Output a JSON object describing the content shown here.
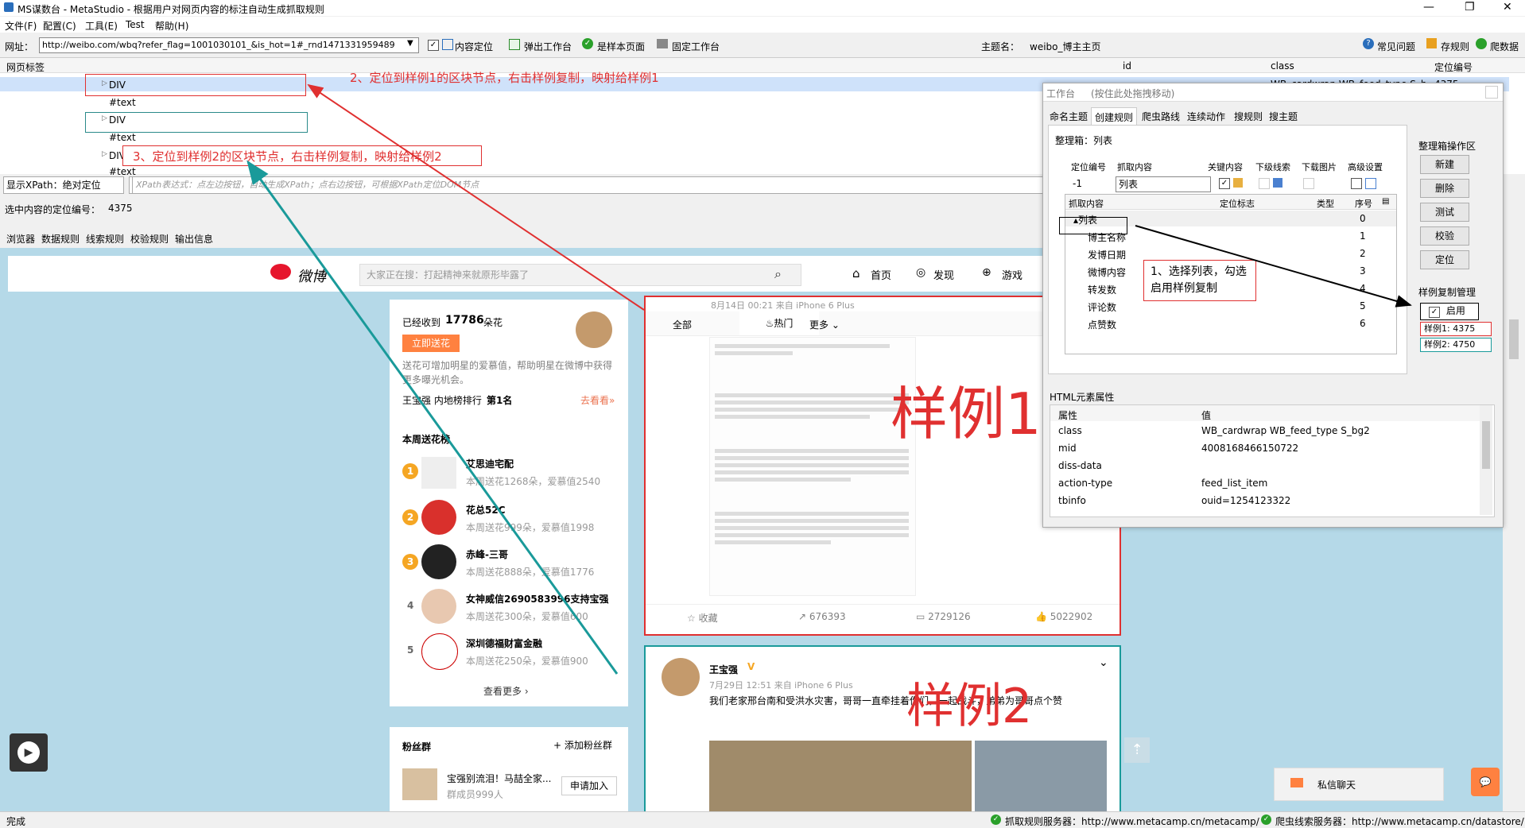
{
  "window": {
    "title": "MS谋数台 - MetaStudio - 根据用户对网页内容的标注自动生成抓取规则",
    "controls": [
      "—",
      "❐",
      "✕"
    ]
  },
  "menu": [
    "文件(F)",
    "配置(C)",
    "工具(E)",
    "Test",
    "帮助(H)"
  ],
  "toolbar": {
    "url_label": "网址：",
    "url_value": "http://weibo.com/wbq?refer_flag=1001030101_&is_hot=1#_rnd1471331959489",
    "content_locate": "内容定位",
    "popup_workbench": "弹出工作台",
    "is_sample_page": "是样本页面",
    "fixed_workbench": "固定工作台",
    "theme_label": "主题名：",
    "theme_value": "weibo_博主主页",
    "faq": "常见问题",
    "save_rule": "存规则",
    "crawl_data": "爬数据"
  },
  "dom_tree": {
    "header": "网页标签",
    "col_id": "id",
    "col_class": "class",
    "col_locate_no": "定位编号",
    "row0_class": "WB_cardwrap WB_feed_type S_b...",
    "row0_no": "4375",
    "nodes": [
      "DIV",
      "#text",
      "DIV",
      "#text",
      "DIV",
      "#text"
    ]
  },
  "xpath": {
    "mode": "显示XPath：绝对定位",
    "placeholder": "XPath表达式：点左边按钮，自动生成XPath；点右边按钮，可根据XPath定位DOM节点",
    "selected_label": "选中内容的定位编号：",
    "selected_value": "4375"
  },
  "bottom_tabs": [
    "浏览器",
    "数据规则",
    "线索规则",
    "校验规则",
    "输出信息"
  ],
  "annotations": {
    "a1": "1、选择列表，勾选启用样例复制",
    "a2": "2、定位到样例1的区块节点，右击样例复制，映射给样例1",
    "a3": "3、定位到样例2的区块节点，右击样例复制，映射给样例2",
    "sample1": "样例1",
    "sample2": "样例2"
  },
  "workbench": {
    "title": "工作台",
    "hint": "(按住此处拖拽移动)",
    "tabs": [
      "命名主题",
      "创建规则",
      "爬虫路线",
      "连续动作",
      "搜规则",
      "搜主题"
    ],
    "box_title": "整理箱：列表",
    "headers": [
      "定位编号",
      "抓取内容",
      "关键内容",
      "下级线索",
      "下载图片",
      "高级设置"
    ],
    "locate_no": "-1",
    "capture_value": "列表",
    "table_headers": [
      "抓取内容",
      "定位标志",
      "类型",
      "序号"
    ],
    "rows": [
      {
        "name": "列表",
        "no": "0"
      },
      {
        "name": "博主名称",
        "no": "1"
      },
      {
        "name": "发博日期",
        "no": "2"
      },
      {
        "name": "微博内容",
        "no": "3"
      },
      {
        "name": "转发数",
        "no": "4"
      },
      {
        "name": "评论数",
        "no": "5"
      },
      {
        "name": "点赞数",
        "no": "6"
      }
    ],
    "ops_title": "整理箱操作区",
    "ops": [
      "新建",
      "删除",
      "测试",
      "校验",
      "定位"
    ],
    "sample_title": "样例复制管理",
    "enable": "启用",
    "sample1_value": "样例1: 4375",
    "sample2_value": "样例2: 4750",
    "html_title": "HTML元素属性",
    "attr_headers": [
      "属性",
      "值"
    ],
    "attrs": [
      {
        "k": "class",
        "v": "WB_cardwrap WB_feed_type S_bg2"
      },
      {
        "k": "mid",
        "v": "4008168466150722"
      },
      {
        "k": "diss-data",
        "v": ""
      },
      {
        "k": "action-type",
        "v": "feed_list_item"
      },
      {
        "k": "tbinfo",
        "v": "ouid=1254123322"
      }
    ]
  },
  "weibo": {
    "logo": "微博",
    "search_placeholder": "大家正在搜：打起精神来就原形毕露了",
    "nav": [
      "首页",
      "发现",
      "游戏"
    ],
    "received": "已经收到",
    "flowers": "17786",
    "flowers_unit": "朵花",
    "send_flower": "立即送花",
    "send_desc": "送花可增加明星的爱慕值，帮助明星在微博中获得更多曝光机会。",
    "rank_text": "王宝强 内地榜排行",
    "rank_no": "第1名",
    "look": "去看看»",
    "weekly": "本周送花榜",
    "givers": [
      {
        "rank": "1",
        "name": "艾思迪宅配",
        "sub": "本周送花1268朵，爱慕值2540"
      },
      {
        "rank": "2",
        "name": "花总52C",
        "sub": "本周送花999朵，爱慕值1998"
      },
      {
        "rank": "3",
        "name": "赤峰-三哥",
        "sub": "本周送花888朵，爱慕值1776"
      },
      {
        "rank": "4",
        "name": "女神威信2690583996支持宝强",
        "sub": "本周送花300朵，爱慕值600"
      },
      {
        "rank": "5",
        "name": "深圳德福财富金融",
        "sub": "本周送花250朵，爱慕值900"
      }
    ],
    "more": "查看更多 ›",
    "fans_group": "粉丝群",
    "add_fans": "添加粉丝群",
    "group_name": "宝强别流泪！马喆全家...",
    "group_members": "群成员999人",
    "apply": "申请加入",
    "feed_date1": "8月14日 00:21 来自 iPhone 6 Plus",
    "feed_tabs": [
      "全部",
      "热门",
      "更多"
    ],
    "collect": "收藏",
    "reposts": "676393",
    "comments": "2729126",
    "likes": "5022902",
    "author": "王宝强",
    "feed_date2": "7月29日 12:51 来自 iPhone 6 Plus",
    "feed_text2": "我们老家邢台南和受洪水灾害，哥哥一直牵挂着你们，一起战斗，弟弟为哥哥点个赞",
    "im": "私信聊天"
  },
  "status": {
    "done": "完成",
    "s1": "抓取规则服务器：http://www.metacamp.cn/metacamp/",
    "s2": "爬虫线索服务器：http://www.metacamp.cn/datastore/"
  }
}
